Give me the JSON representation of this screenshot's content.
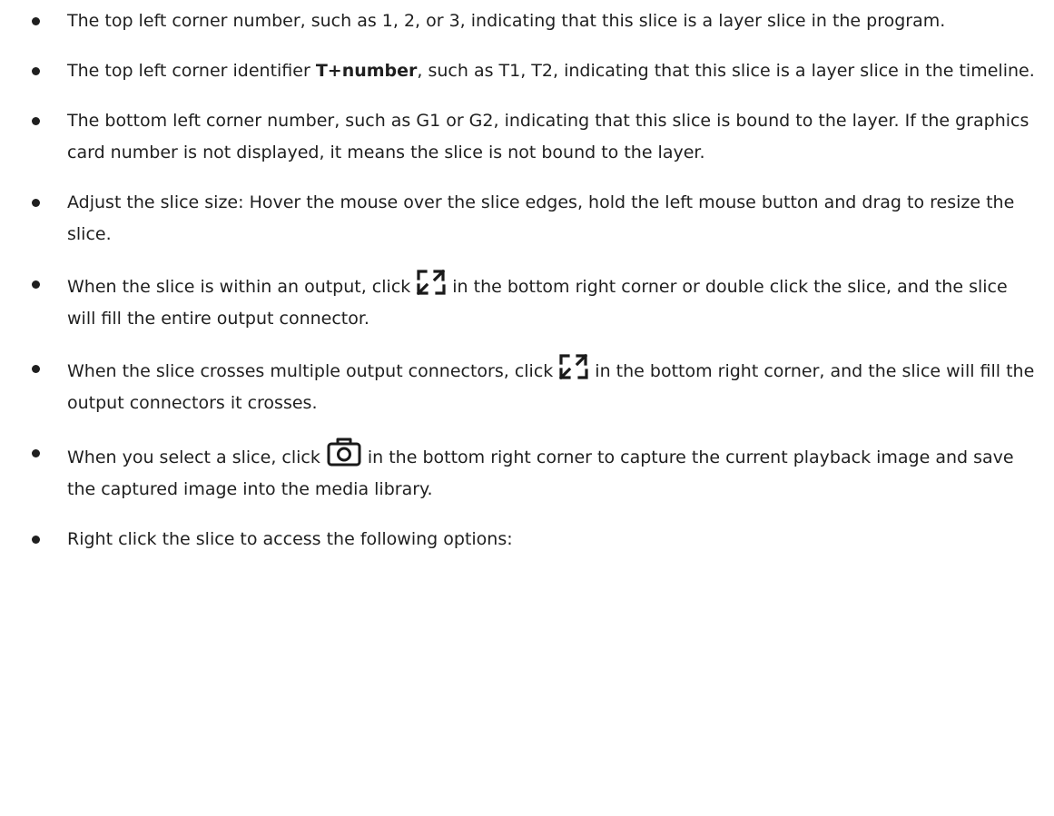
{
  "bullets": [
    {
      "text": "The top left corner number, such as 1, 2, or 3, indicating that this slice is a layer slice in the program."
    },
    {
      "before": "The top left corner identifier ",
      "bold": "T+number",
      "after": ", such as T1, T2, indicating that this slice is a layer slice in the timeline."
    },
    {
      "text": "The bottom left corner number, such as G1 or G2, indicating that this slice is bound to the layer. If the graphics card number is not displayed, it means the slice is not bound to the layer."
    },
    {
      "text": "Adjust the slice size: Hover the mouse over the slice edges, hold the left mouse button and drag to resize the slice."
    },
    {
      "before": "When the slice is within an output, click",
      "icon": "fill-screen-icon",
      "after": "in the bottom right corner or double click the slice, and the slice will fill the entire output connector."
    },
    {
      "before": "When the slice crosses multiple output connectors, click",
      "icon": "fill-screen-icon",
      "after": "in the bottom right corner, and the slice will fill the output connectors it crosses."
    },
    {
      "before": "When you select a slice, click",
      "icon": "camera-icon",
      "after": "in the bottom right corner to capture the current playback image and save the captured image into the media library."
    },
    {
      "text": "Right click the slice to access the following options:"
    }
  ]
}
